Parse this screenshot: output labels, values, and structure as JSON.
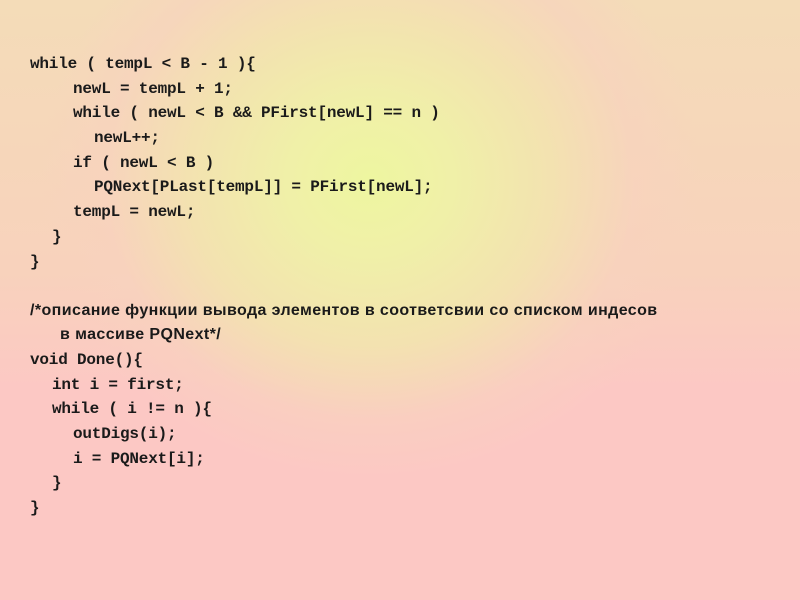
{
  "slide": {
    "code_block_1": [
      {
        "text": "while ( tempL < B - 1 ){",
        "indent": 0
      },
      {
        "text": "newL = tempL + 1;",
        "indent": 2
      },
      {
        "text": "while ( newL < B && PFirst[newL] == n )",
        "indent": 2
      },
      {
        "text": "newL++;",
        "indent": 3
      },
      {
        "text": "if ( newL < B )",
        "indent": 2
      },
      {
        "text": "PQNext[PLast[tempL]] = PFirst[newL];",
        "indent": 3
      },
      {
        "text": "tempL = newL;",
        "indent": 2
      },
      {
        "text": "}",
        "indent": 1
      },
      {
        "text": "}",
        "indent": 0
      }
    ],
    "comment": {
      "line1": "/*описание функции вывода элементов в соответсвии со списком индесов",
      "line2": "в массиве PQNext*/"
    },
    "code_block_2": [
      {
        "text": "void Done(){",
        "indent": 0
      },
      {
        "text": "int i = first;",
        "indent": 1
      },
      {
        "text": "while ( i != n ){",
        "indent": 1
      },
      {
        "text": "outDigs(i);",
        "indent": 2
      },
      {
        "text": "i = PQNext[i];",
        "indent": 2
      },
      {
        "text": "}",
        "indent": 1
      },
      {
        "text": "}",
        "indent": 0
      }
    ],
    "colors": {
      "text": "#1a1a1a",
      "background_top": "#eef6a0",
      "background_bottom": "#fcc8c4"
    }
  }
}
